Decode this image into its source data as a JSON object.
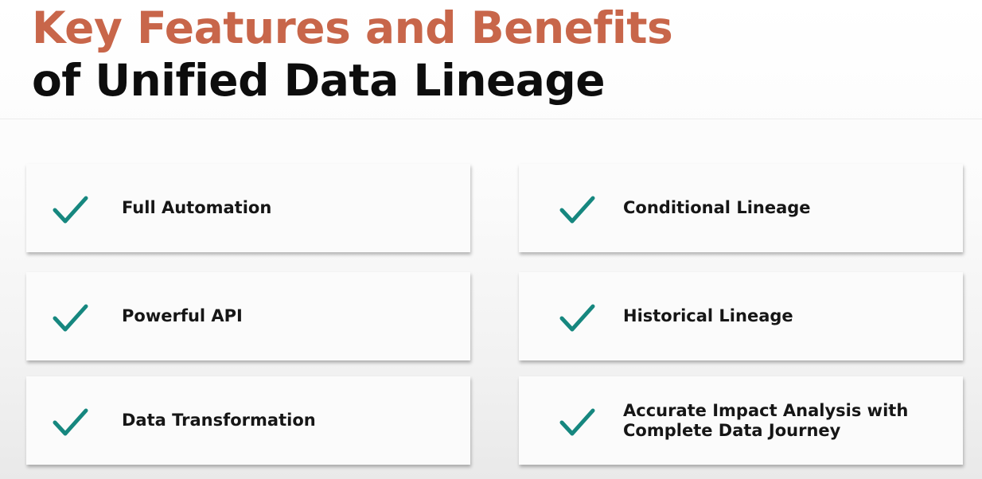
{
  "title": {
    "line1": "Key Features and Benefits",
    "line2": "of Unified Data Lineage"
  },
  "colors": {
    "title_accent": "#c8664a",
    "title_main": "#0d0d0d",
    "check": "#16877f",
    "card_background": "#fbfbfb"
  },
  "features": [
    {
      "label": "Full Automation",
      "icon": "check-icon"
    },
    {
      "label": "Conditional Lineage",
      "icon": "check-icon"
    },
    {
      "label": "Powerful API",
      "icon": "check-icon"
    },
    {
      "label": "Historical Lineage",
      "icon": "check-icon"
    },
    {
      "label": "Data Transformation",
      "icon": "check-icon"
    },
    {
      "label": "Accurate Impact Analysis with Complete Data Journey",
      "icon": "check-icon"
    }
  ]
}
